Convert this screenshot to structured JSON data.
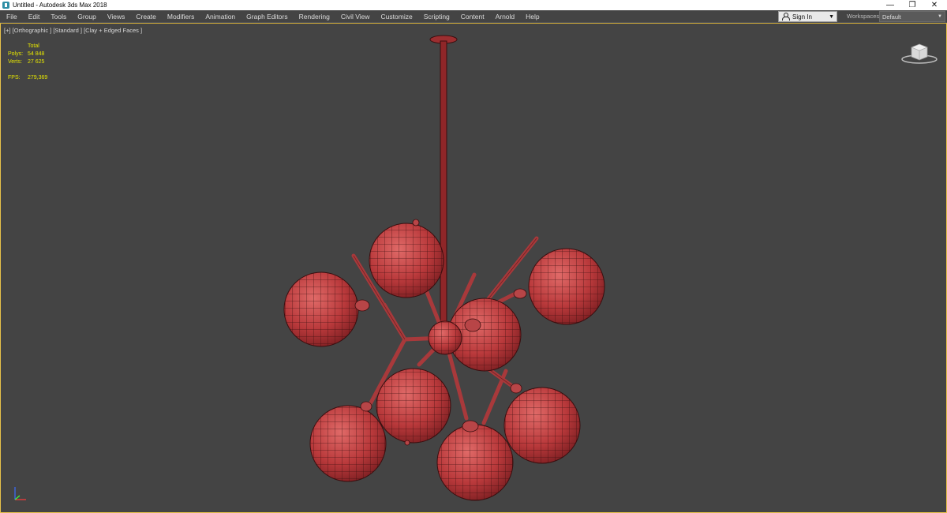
{
  "window": {
    "title": "Untitled - Autodesk 3ds Max 2018",
    "controls": {
      "minimize": "—",
      "restore": "❐",
      "close": "✕"
    }
  },
  "menu": [
    "File",
    "Edit",
    "Tools",
    "Group",
    "Views",
    "Create",
    "Modifiers",
    "Animation",
    "Graph Editors",
    "Rendering",
    "Civil View",
    "Customize",
    "Scripting",
    "Content",
    "Arnold",
    "Help"
  ],
  "account": {
    "signin_label": "Sign In",
    "workspaces_label": "Workspaces:",
    "workspace_value": "Default"
  },
  "viewport": {
    "label": "[+] [Orthographic ] [Standard ] [Clay + Edged Faces ]",
    "stats": {
      "header": "Total",
      "polys_label": "Polys:",
      "polys_value": "54 848",
      "verts_label": "Verts:",
      "verts_value": "27 625",
      "fps_label": "FPS:",
      "fps_value": "279,369"
    }
  },
  "colors": {
    "mesh": "#b5383a",
    "wire": "#3a0e0f",
    "stats": "#e6e600",
    "viewport_border": "#e8c24a"
  }
}
